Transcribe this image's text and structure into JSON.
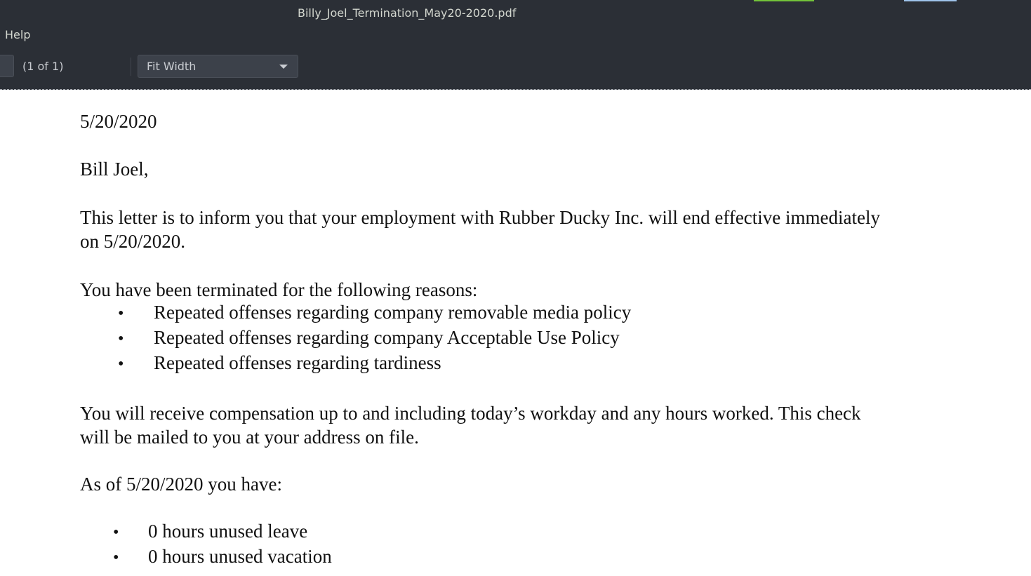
{
  "window": {
    "title": "Billy_Joel_Termination_May20-2020.pdf"
  },
  "menu": {
    "items": [
      "Help"
    ]
  },
  "toolbar": {
    "page_count": "(1 of 1)",
    "zoom_value": "Fit Width"
  },
  "colors": {
    "chrome_bg": "#2b2f36",
    "accent_green": "#73c43a",
    "accent_blue": "#9ec3ea"
  },
  "letter": {
    "date": "5/20/2020",
    "salutation": "Bill Joel,",
    "intro_line1": "This letter is to inform you that your employment with Rubber Ducky Inc. will end effective immediately",
    "intro_line2": "on 5/20/2020.",
    "reasons_heading": "You have been terminated for the following reasons:",
    "reasons": [
      "Repeated offenses regarding company removable media policy",
      "Repeated offenses regarding company Acceptable Use Policy",
      "Repeated offenses regarding tardiness"
    ],
    "comp_line1": "You will receive compensation up to and including today’s workday and any hours worked.  This check",
    "comp_line2": "will be mailed to you at your address on file.",
    "asof_heading": "As of 5/20/2020 you have:",
    "balances": [
      "0 hours unused leave",
      "0 hours unused vacation"
    ],
    "bullet_glyph": "•"
  }
}
